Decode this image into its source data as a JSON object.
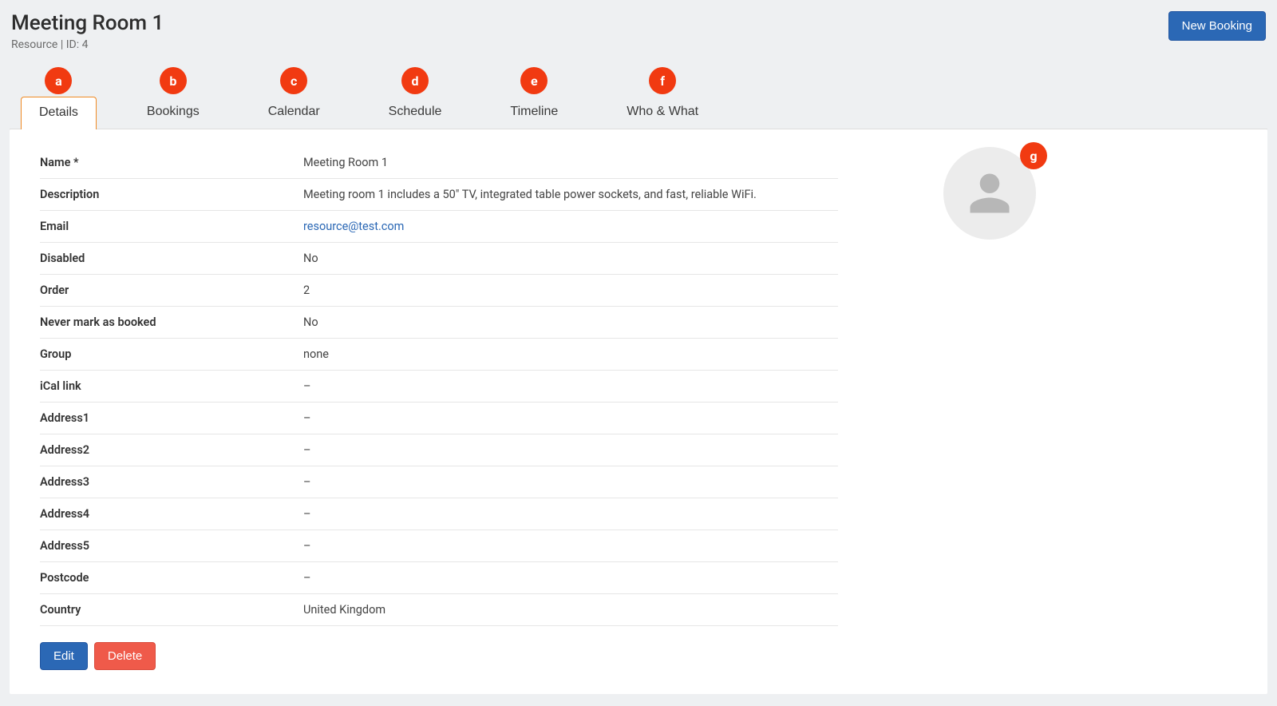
{
  "header": {
    "title": "Meeting Room 1",
    "subtitle": "Resource | ID: 4",
    "new_booking_label": "New Booking"
  },
  "tabs": [
    {
      "badge": "a",
      "label": "Details",
      "active": true
    },
    {
      "badge": "b",
      "label": "Bookings",
      "active": false
    },
    {
      "badge": "c",
      "label": "Calendar",
      "active": false
    },
    {
      "badge": "d",
      "label": "Schedule",
      "active": false
    },
    {
      "badge": "e",
      "label": "Timeline",
      "active": false
    },
    {
      "badge": "f",
      "label": "Who & What",
      "active": false
    }
  ],
  "avatar": {
    "badge": "g"
  },
  "details": [
    {
      "label": "Name *",
      "value": "Meeting Room 1",
      "is_link": false
    },
    {
      "label": "Description",
      "value": "Meeting room 1 includes a 50\" TV, integrated table power sockets, and fast, reliable WiFi.",
      "is_link": false
    },
    {
      "label": "Email",
      "value": "resource@test.com",
      "is_link": true
    },
    {
      "label": "Disabled",
      "value": "No",
      "is_link": false
    },
    {
      "label": "Order",
      "value": "2",
      "is_link": false
    },
    {
      "label": "Never mark as booked",
      "value": "No",
      "is_link": false
    },
    {
      "label": "Group",
      "value": "none",
      "is_link": false
    },
    {
      "label": "iCal link",
      "value": "–",
      "is_link": false
    },
    {
      "label": "Address1",
      "value": "–",
      "is_link": false
    },
    {
      "label": "Address2",
      "value": "–",
      "is_link": false
    },
    {
      "label": "Address3",
      "value": "–",
      "is_link": false
    },
    {
      "label": "Address4",
      "value": "–",
      "is_link": false
    },
    {
      "label": "Address5",
      "value": "–",
      "is_link": false
    },
    {
      "label": "Postcode",
      "value": "–",
      "is_link": false
    },
    {
      "label": "Country",
      "value": "United Kingdom",
      "is_link": false
    }
  ],
  "actions": {
    "edit_label": "Edit",
    "delete_label": "Delete"
  }
}
